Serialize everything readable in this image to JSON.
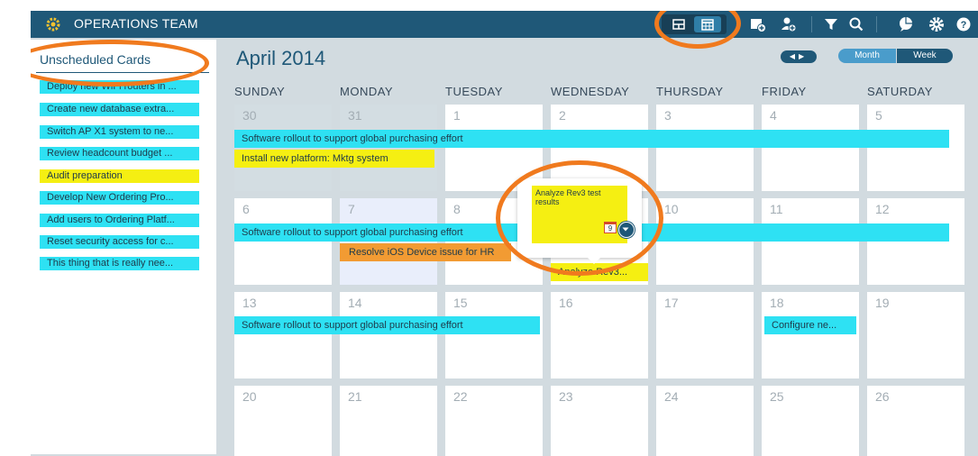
{
  "app": {
    "title": "OPERATIONS TEAM"
  },
  "sidebar": {
    "title": "Unscheduled Cards",
    "cards": [
      {
        "label": "Deploy new WiFi routers in ...",
        "color": "cyan"
      },
      {
        "label": "Create new database extra...",
        "color": "cyan"
      },
      {
        "label": "Switch AP X1 system to ne...",
        "color": "cyan"
      },
      {
        "label": "Review headcount budget ...",
        "color": "cyan"
      },
      {
        "label": "Audit preparation",
        "color": "yellow"
      },
      {
        "label": "Develop New Ordering Pro...",
        "color": "cyan"
      },
      {
        "label": "Add users to Ordering Platf...",
        "color": "cyan"
      },
      {
        "label": "Reset security access for c...",
        "color": "cyan"
      },
      {
        "label": "This thing that is really nee...",
        "color": "cyan"
      }
    ]
  },
  "calendar": {
    "month_title": "April 2014",
    "view_month": "Month",
    "view_week": "Week",
    "days_of_week": [
      "SUNDAY",
      "MONDAY",
      "TUESDAY",
      "WEDNESDAY",
      "THURSDAY",
      "FRIDAY",
      "SATURDAY"
    ],
    "weeks": [
      [
        "30",
        "31",
        "1",
        "2",
        "3",
        "4",
        "5"
      ],
      [
        "6",
        "7",
        "8",
        "9",
        "10",
        "11",
        "12"
      ],
      [
        "13",
        "14",
        "15",
        "16",
        "17",
        "18",
        "19"
      ],
      [
        "20",
        "21",
        "22",
        "23",
        "24",
        "25",
        "26"
      ]
    ],
    "events": {
      "rollout_1": "Software rollout to support global purchasing effort",
      "install": "Install new platform: Mktg system",
      "rollout_2": "Software rollout to support global purchasing effort",
      "ios": "Resolve iOS Device issue for HR",
      "analyze_wed": "Analyze Rev3...",
      "rollout_3": "Software rollout to support global purchasing effort",
      "configure": "Configure ne..."
    },
    "popup": {
      "text": "Analyze Rev3 test results",
      "badge": "9"
    }
  },
  "colors": {
    "header": "#1f5878",
    "event_cyan": "#2ee1f3",
    "event_yellow": "#f5ef12",
    "event_orange": "#f29b33",
    "highlight": "#f07a1e"
  },
  "icons": [
    "gear-logo-icon",
    "board-view-icon",
    "calendar-view-icon",
    "add-card-icon",
    "add-user-icon",
    "filter-icon",
    "search-icon",
    "chat-icon",
    "settings-icon",
    "help-icon",
    "chevron-down-icon"
  ]
}
